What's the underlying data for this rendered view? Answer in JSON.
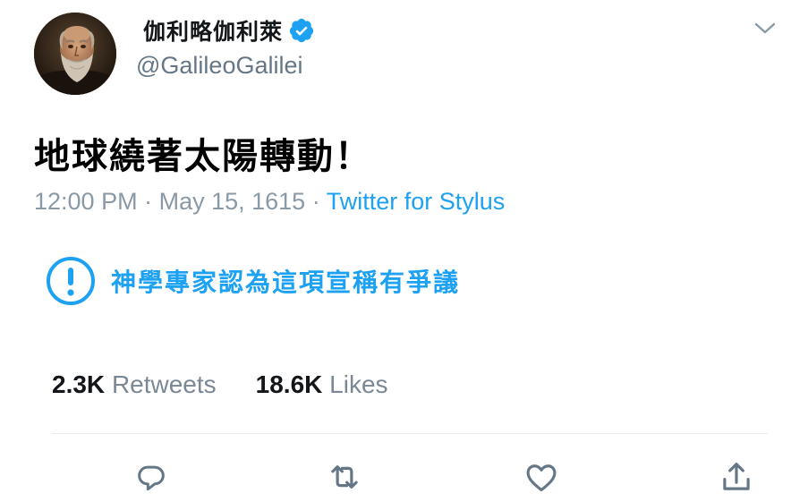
{
  "user": {
    "display_name": "伽利略伽利萊",
    "handle": "@GalileoGalilei",
    "verified": true,
    "avatar_icon": "galileo-portrait"
  },
  "tweet": {
    "text": "地球繞著太陽轉動！",
    "time": "12:00 PM",
    "separator": " · ",
    "date": "May 15, 1615",
    "source": "Twitter for Stylus"
  },
  "notice": {
    "icon": "exclamation-circle-icon",
    "text": "神學專家認為這項宣稱有爭議"
  },
  "stats": {
    "retweets_count": "2.3K",
    "retweets_label": "Retweets",
    "likes_count": "18.6K",
    "likes_label": "Likes"
  },
  "actions": [
    {
      "icon": "reply-icon"
    },
    {
      "icon": "retweet-icon"
    },
    {
      "icon": "like-icon"
    },
    {
      "icon": "share-icon"
    }
  ],
  "colors": {
    "accent": "#1da1f2",
    "muted": "#657786",
    "text": "#14171a",
    "background": "#ffffff"
  }
}
